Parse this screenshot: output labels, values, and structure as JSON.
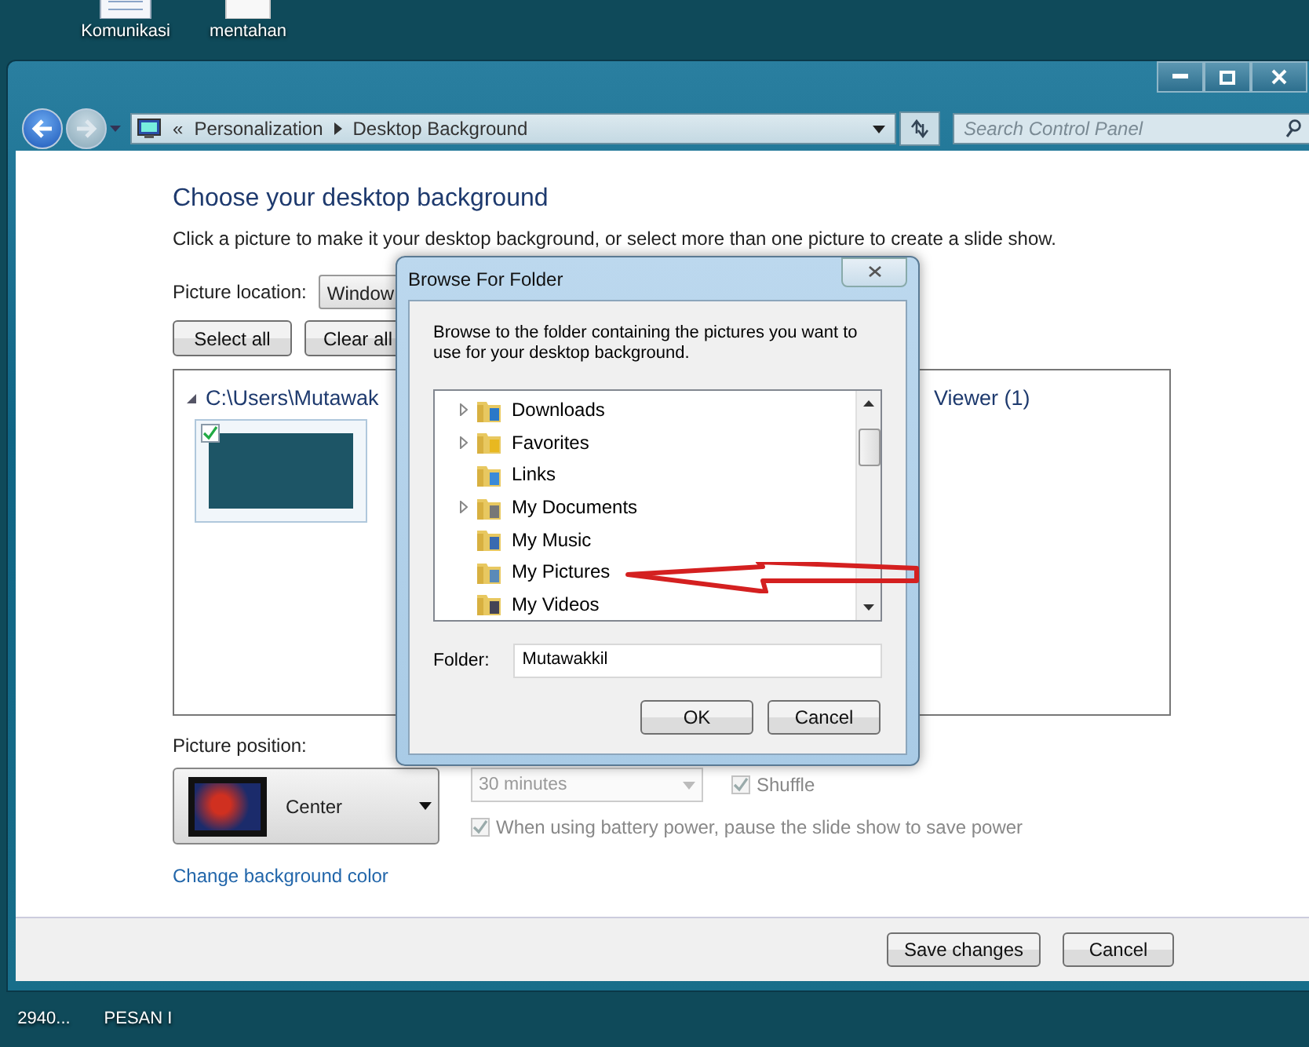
{
  "desktop": {
    "icons": [
      {
        "label": "Komunikasi",
        "kind": "document"
      },
      {
        "label": "mentahan",
        "kind": "blank"
      },
      {
        "label": "2940...",
        "kind": "blank"
      },
      {
        "label": "PESAN I",
        "kind": "blank"
      }
    ]
  },
  "window": {
    "address_prefix": "«",
    "breadcrumb": [
      "Personalization",
      "Desktop Background"
    ],
    "search": {
      "placeholder": "Search Control Panel"
    }
  },
  "page": {
    "heading": "Choose your desktop background",
    "description": "Click a picture to make it your desktop background, or select more than one picture to create a slide show.",
    "location": {
      "label": "Picture location:",
      "value": "Window"
    },
    "buttons": [
      "Select all",
      "Clear all"
    ],
    "group": {
      "title_left": "C:\\Users\\Mutawak",
      "title_right": "Viewer (1)",
      "pictures": [
        {
          "checked": true
        }
      ]
    },
    "position": {
      "label": "Picture position:",
      "value": "Center"
    },
    "interval": {
      "value": "30 minutes",
      "disabled": true
    },
    "shuffle": {
      "label": "Shuffle",
      "checked": true,
      "disabled": true
    },
    "battery": {
      "label": "When using battery power, pause the slide show to save power",
      "checked": true,
      "disabled": true
    },
    "link": "Change background color"
  },
  "footer_buttons": [
    "Save changes",
    "Cancel"
  ],
  "dialog": {
    "title": "Browse For Folder",
    "instruction": "Browse to the folder containing the pictures you want to use for your desktop background.",
    "tree": [
      {
        "label": "Downloads",
        "expandable": true,
        "kind": "downloads"
      },
      {
        "label": "Favorites",
        "expandable": true,
        "kind": "favorites"
      },
      {
        "label": "Links",
        "expandable": false,
        "kind": "links"
      },
      {
        "label": "My Documents",
        "expandable": true,
        "kind": "documents"
      },
      {
        "label": "My Music",
        "expandable": false,
        "kind": "music"
      },
      {
        "label": "My Pictures",
        "expandable": false,
        "kind": "pictures"
      },
      {
        "label": "My Videos",
        "expandable": false,
        "kind": "videos"
      }
    ],
    "folder": {
      "label": "Folder:",
      "value": "Mutawakkil"
    },
    "buttons": [
      "OK",
      "Cancel"
    ]
  },
  "annotations": [
    {
      "kind": "arrow"
    }
  ]
}
